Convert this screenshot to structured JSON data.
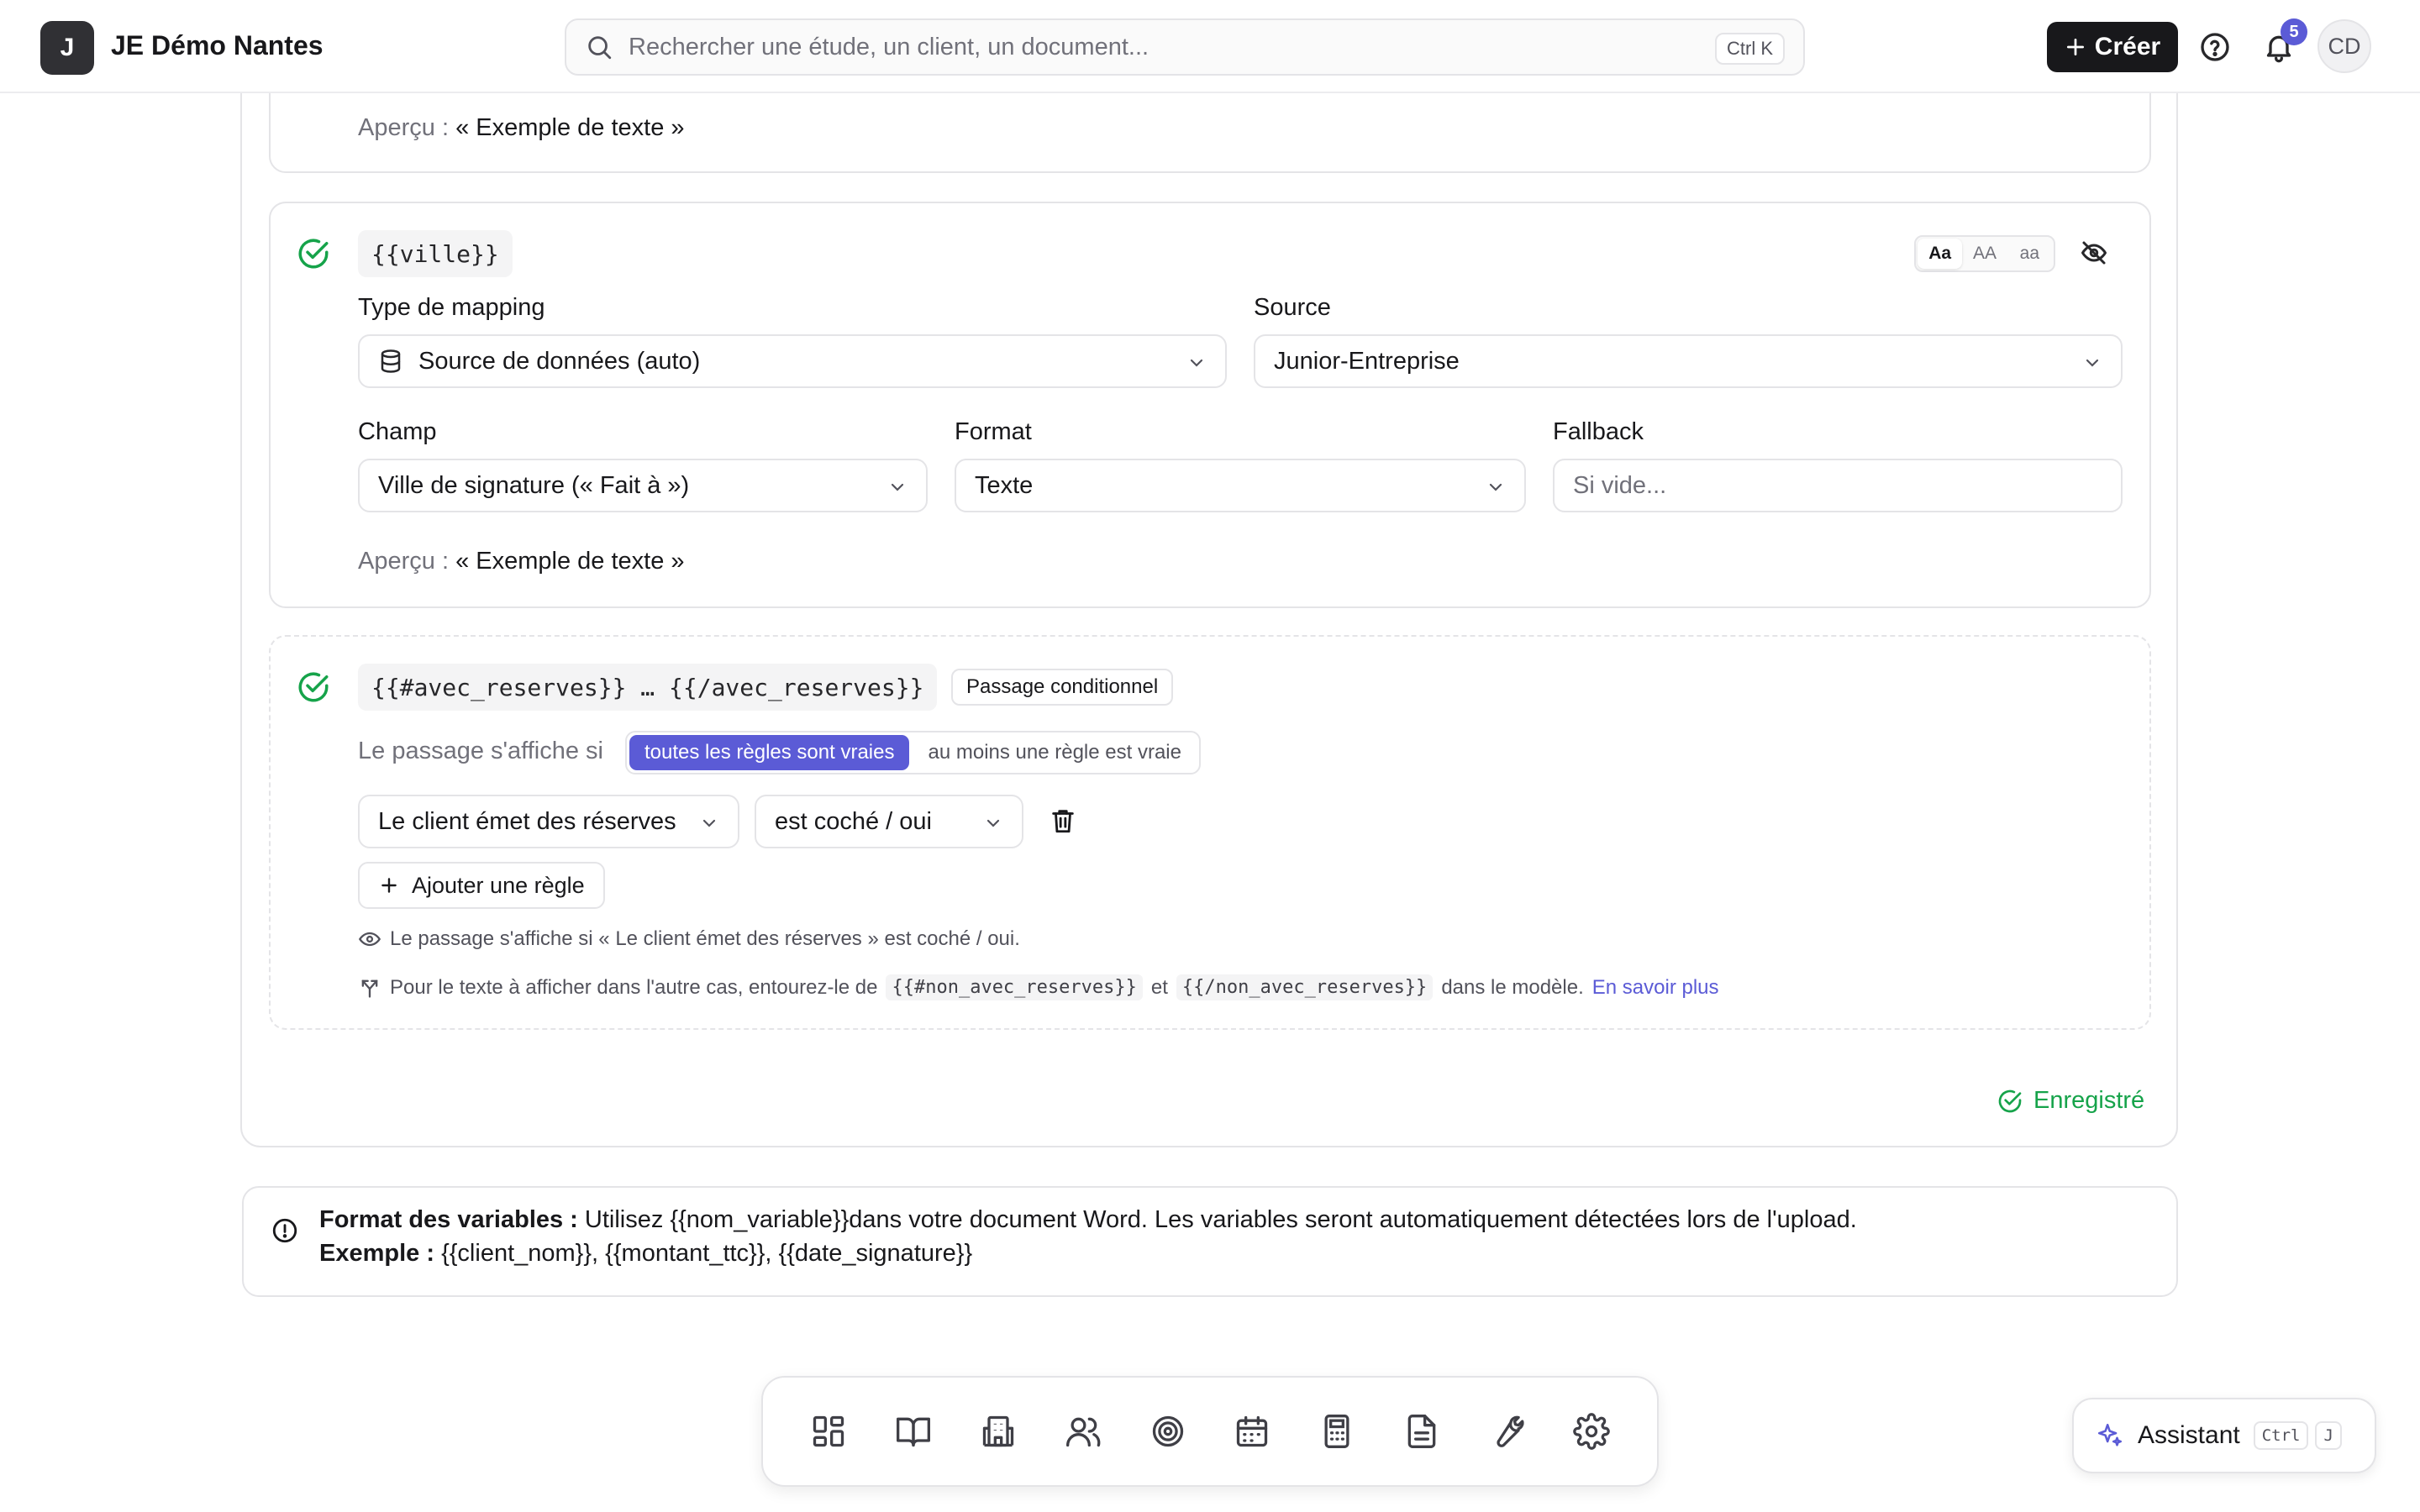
{
  "header": {
    "logo_letter": "J",
    "app_name": "JE Démo Nantes",
    "search_placeholder": "Rechercher une étude, un client, un document...",
    "search_shortcut": "Ctrl K",
    "create_label": "Créer",
    "notifications_count": "5",
    "avatar_initials": "CD"
  },
  "card_top_partial": {
    "preview_label": "Aperçu :",
    "preview_value": "« Exemple de texte »"
  },
  "var_ville": {
    "tag": "{{ville}}",
    "case_options": [
      "Aa",
      "AA",
      "aa"
    ],
    "case_selected": "Aa",
    "mapping_type_label": "Type de mapping",
    "mapping_type_value": "Source de données (auto)",
    "source_label": "Source",
    "source_value": "Junior-Entreprise",
    "field_label": "Champ",
    "field_value": "Ville de signature (« Fait à »)",
    "format_label": "Format",
    "format_value": "Texte",
    "fallback_label": "Fallback",
    "fallback_placeholder": "Si vide...",
    "preview_label": "Aperçu :",
    "preview_value": "« Exemple de texte »"
  },
  "var_conditional": {
    "tag": "{{#avec_reserves}} … {{/avec_reserves}}",
    "badge": "Passage conditionnel",
    "condition_label": "Le passage s'affiche si",
    "mode_options": [
      "toutes les règles sont vraies",
      "au moins une règle est vraie"
    ],
    "mode_selected": "toutes les règles sont vraies",
    "rule_field": "Le client émet des réserves",
    "rule_operator": "est coché / oui",
    "add_rule_label": "Ajouter une règle",
    "summary": "Le passage s'affiche si « Le client émet des réserves » est coché / oui.",
    "else_hint_prefix": "Pour le texte à afficher dans l'autre cas, entourez-le de",
    "else_open_tag": "{{#non_avec_reserves}}",
    "else_and": "et",
    "else_close_tag": "{{/non_avec_reserves}}",
    "else_hint_suffix": "dans le modèle.",
    "learn_more": "En savoir plus"
  },
  "save_status": "Enregistré",
  "info": {
    "title": "Format des variables :",
    "text": "Utilisez {{nom_variable}}dans votre document Word. Les variables seront automatiquement détectées lors de l'upload.",
    "example_label": "Exemple :",
    "example_text": "{{client_nom}}, {{montant_ttc}}, {{date_signature}}"
  },
  "dock": {
    "icons": [
      "dashboard-icon",
      "book-icon",
      "building-icon",
      "users-icon",
      "target-icon",
      "calendar-icon",
      "calculator-icon",
      "document-icon",
      "wrench-icon",
      "settings-icon"
    ]
  },
  "assistant": {
    "label": "Assistant",
    "kbd1": "Ctrl",
    "kbd2": "J"
  },
  "colors": {
    "accent": "#5b5bd6",
    "success": "#16a34a",
    "dark": "#18181b"
  }
}
